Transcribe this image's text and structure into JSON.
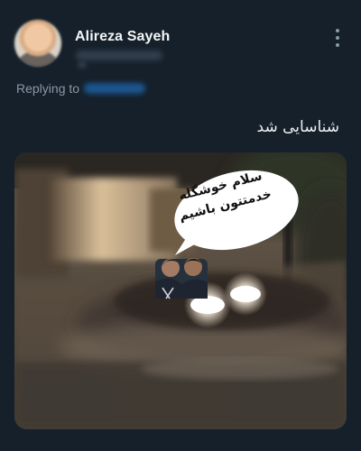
{
  "tweet": {
    "author": {
      "display_name": "Alireza Sayeh",
      "avatar_icon": "avatar-photo"
    },
    "more_icon": "more-vertical-icon",
    "reply_prefix": "Replying to",
    "text": "شناسایی شد",
    "media": {
      "bubble_lines": [
        "سلام خوشگله",
        "خدمتتون باشیم"
      ]
    }
  },
  "colors": {
    "background": "#15202b",
    "link": "#1d9bf0",
    "secondary_text": "#8b98a5"
  }
}
